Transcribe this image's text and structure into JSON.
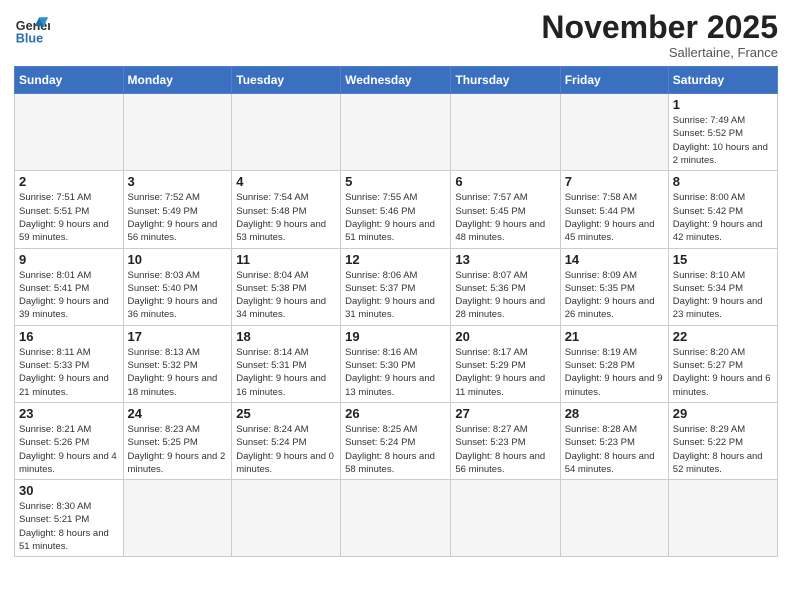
{
  "header": {
    "logo_general": "General",
    "logo_blue": "Blue",
    "month": "November 2025",
    "location": "Sallertaine, France"
  },
  "days_of_week": [
    "Sunday",
    "Monday",
    "Tuesday",
    "Wednesday",
    "Thursday",
    "Friday",
    "Saturday"
  ],
  "weeks": [
    [
      {
        "day": "",
        "info": ""
      },
      {
        "day": "",
        "info": ""
      },
      {
        "day": "",
        "info": ""
      },
      {
        "day": "",
        "info": ""
      },
      {
        "day": "",
        "info": ""
      },
      {
        "day": "",
        "info": ""
      },
      {
        "day": "1",
        "info": "Sunrise: 7:49 AM\nSunset: 5:52 PM\nDaylight: 10 hours and 2 minutes."
      }
    ],
    [
      {
        "day": "2",
        "info": "Sunrise: 7:51 AM\nSunset: 5:51 PM\nDaylight: 9 hours and 59 minutes."
      },
      {
        "day": "3",
        "info": "Sunrise: 7:52 AM\nSunset: 5:49 PM\nDaylight: 9 hours and 56 minutes."
      },
      {
        "day": "4",
        "info": "Sunrise: 7:54 AM\nSunset: 5:48 PM\nDaylight: 9 hours and 53 minutes."
      },
      {
        "day": "5",
        "info": "Sunrise: 7:55 AM\nSunset: 5:46 PM\nDaylight: 9 hours and 51 minutes."
      },
      {
        "day": "6",
        "info": "Sunrise: 7:57 AM\nSunset: 5:45 PM\nDaylight: 9 hours and 48 minutes."
      },
      {
        "day": "7",
        "info": "Sunrise: 7:58 AM\nSunset: 5:44 PM\nDaylight: 9 hours and 45 minutes."
      },
      {
        "day": "8",
        "info": "Sunrise: 8:00 AM\nSunset: 5:42 PM\nDaylight: 9 hours and 42 minutes."
      }
    ],
    [
      {
        "day": "9",
        "info": "Sunrise: 8:01 AM\nSunset: 5:41 PM\nDaylight: 9 hours and 39 minutes."
      },
      {
        "day": "10",
        "info": "Sunrise: 8:03 AM\nSunset: 5:40 PM\nDaylight: 9 hours and 36 minutes."
      },
      {
        "day": "11",
        "info": "Sunrise: 8:04 AM\nSunset: 5:38 PM\nDaylight: 9 hours and 34 minutes."
      },
      {
        "day": "12",
        "info": "Sunrise: 8:06 AM\nSunset: 5:37 PM\nDaylight: 9 hours and 31 minutes."
      },
      {
        "day": "13",
        "info": "Sunrise: 8:07 AM\nSunset: 5:36 PM\nDaylight: 9 hours and 28 minutes."
      },
      {
        "day": "14",
        "info": "Sunrise: 8:09 AM\nSunset: 5:35 PM\nDaylight: 9 hours and 26 minutes."
      },
      {
        "day": "15",
        "info": "Sunrise: 8:10 AM\nSunset: 5:34 PM\nDaylight: 9 hours and 23 minutes."
      }
    ],
    [
      {
        "day": "16",
        "info": "Sunrise: 8:11 AM\nSunset: 5:33 PM\nDaylight: 9 hours and 21 minutes."
      },
      {
        "day": "17",
        "info": "Sunrise: 8:13 AM\nSunset: 5:32 PM\nDaylight: 9 hours and 18 minutes."
      },
      {
        "day": "18",
        "info": "Sunrise: 8:14 AM\nSunset: 5:31 PM\nDaylight: 9 hours and 16 minutes."
      },
      {
        "day": "19",
        "info": "Sunrise: 8:16 AM\nSunset: 5:30 PM\nDaylight: 9 hours and 13 minutes."
      },
      {
        "day": "20",
        "info": "Sunrise: 8:17 AM\nSunset: 5:29 PM\nDaylight: 9 hours and 11 minutes."
      },
      {
        "day": "21",
        "info": "Sunrise: 8:19 AM\nSunset: 5:28 PM\nDaylight: 9 hours and 9 minutes."
      },
      {
        "day": "22",
        "info": "Sunrise: 8:20 AM\nSunset: 5:27 PM\nDaylight: 9 hours and 6 minutes."
      }
    ],
    [
      {
        "day": "23",
        "info": "Sunrise: 8:21 AM\nSunset: 5:26 PM\nDaylight: 9 hours and 4 minutes."
      },
      {
        "day": "24",
        "info": "Sunrise: 8:23 AM\nSunset: 5:25 PM\nDaylight: 9 hours and 2 minutes."
      },
      {
        "day": "25",
        "info": "Sunrise: 8:24 AM\nSunset: 5:24 PM\nDaylight: 9 hours and 0 minutes."
      },
      {
        "day": "26",
        "info": "Sunrise: 8:25 AM\nSunset: 5:24 PM\nDaylight: 8 hours and 58 minutes."
      },
      {
        "day": "27",
        "info": "Sunrise: 8:27 AM\nSunset: 5:23 PM\nDaylight: 8 hours and 56 minutes."
      },
      {
        "day": "28",
        "info": "Sunrise: 8:28 AM\nSunset: 5:23 PM\nDaylight: 8 hours and 54 minutes."
      },
      {
        "day": "29",
        "info": "Sunrise: 8:29 AM\nSunset: 5:22 PM\nDaylight: 8 hours and 52 minutes."
      }
    ],
    [
      {
        "day": "30",
        "info": "Sunrise: 8:30 AM\nSunset: 5:21 PM\nDaylight: 8 hours and 51 minutes."
      },
      {
        "day": "",
        "info": ""
      },
      {
        "day": "",
        "info": ""
      },
      {
        "day": "",
        "info": ""
      },
      {
        "day": "",
        "info": ""
      },
      {
        "day": "",
        "info": ""
      },
      {
        "day": "",
        "info": ""
      }
    ]
  ]
}
